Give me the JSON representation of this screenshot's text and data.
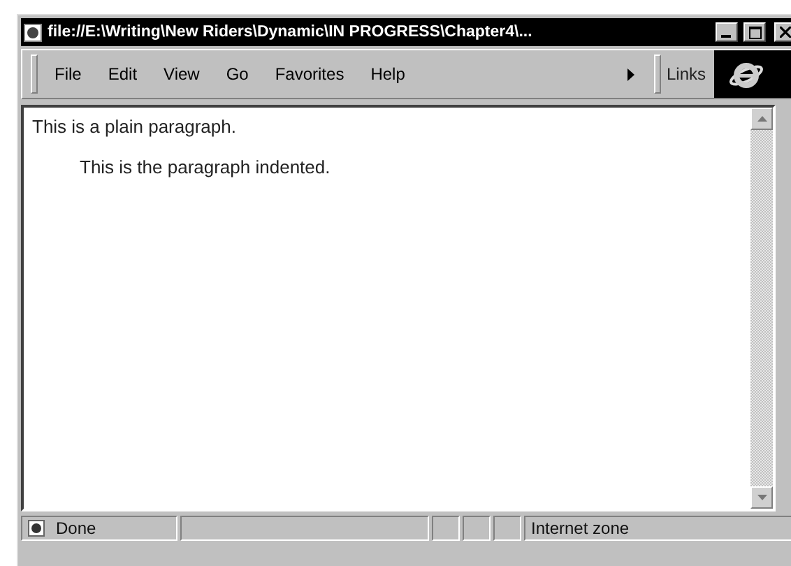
{
  "window": {
    "title": "file://E:\\Writing\\New Riders\\Dynamic\\IN PROGRESS\\Chapter4\\..."
  },
  "menu": [
    "File",
    "Edit",
    "View",
    "Go",
    "Favorites",
    "Help"
  ],
  "links_label": "Links",
  "content": {
    "paragraphs": [
      {
        "text": "This is a plain paragraph.",
        "kind": "plain"
      },
      {
        "text": "This is the paragraph indented.",
        "kind": "indented"
      }
    ]
  },
  "status_bar": {
    "status": "Done",
    "zone": "Internet zone"
  }
}
